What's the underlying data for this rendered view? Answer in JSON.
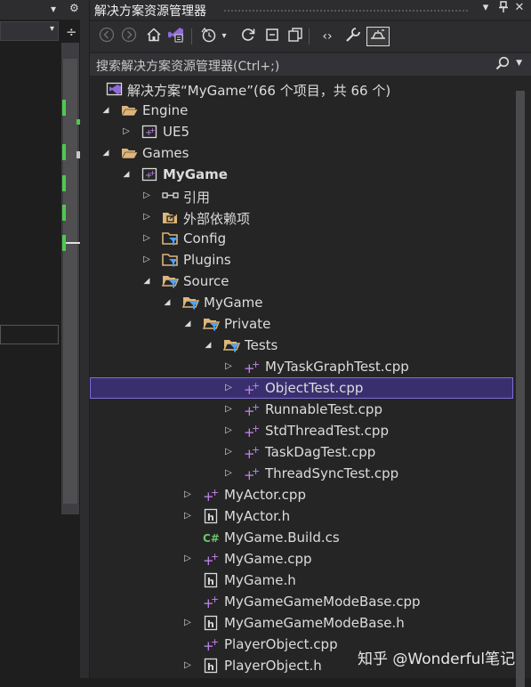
{
  "left_panel": {
    "pin_glyph": "▾",
    "gear_glyph": "⚙",
    "split_glyph": "÷"
  },
  "explorer": {
    "title": "解决方案资源管理器",
    "title_buttons": [
      "▾",
      "📌",
      "✕"
    ],
    "search_placeholder": "搜索解决方案资源管理器(Ctrl+;)",
    "toolbar_icons": [
      "back-icon",
      "forward-icon",
      "home-icon",
      "vs-switch-icon",
      "history-icon",
      "refresh-icon",
      "collapse-all-icon",
      "show-all-files-icon",
      "code-view-icon",
      "properties-wrench-icon",
      "preview-icon"
    ],
    "tree": [
      {
        "text": "解决方案“MyGame”(66 个项目，共 66 个)",
        "level": 0,
        "arrow": "",
        "icon": "solution",
        "bold": false
      },
      {
        "text": "Engine",
        "level": 1,
        "arrow": "open",
        "icon": "folder-open",
        "bold": false
      },
      {
        "text": "UE5",
        "level": 2,
        "arrow": "closed",
        "icon": "project",
        "bold": false
      },
      {
        "text": "Games",
        "level": 1,
        "arrow": "open",
        "icon": "folder-open",
        "bold": false
      },
      {
        "text": "MyGame",
        "level": 2,
        "arrow": "open",
        "icon": "project",
        "bold": true
      },
      {
        "text": "引用",
        "level": 3,
        "arrow": "closed",
        "icon": "references",
        "bold": false
      },
      {
        "text": "外部依赖项",
        "level": 3,
        "arrow": "closed",
        "icon": "external-deps",
        "bold": false
      },
      {
        "text": "Config",
        "level": 3,
        "arrow": "closed",
        "icon": "filter-folder",
        "bold": false
      },
      {
        "text": "Plugins",
        "level": 3,
        "arrow": "closed",
        "icon": "filter-folder",
        "bold": false
      },
      {
        "text": "Source",
        "level": 3,
        "arrow": "open",
        "icon": "filter-folder-open",
        "bold": false
      },
      {
        "text": "MyGame",
        "level": 4,
        "arrow": "open",
        "icon": "filter-folder-open",
        "bold": false
      },
      {
        "text": "Private",
        "level": 5,
        "arrow": "open",
        "icon": "filter-folder-open",
        "bold": false
      },
      {
        "text": "Tests",
        "level": 6,
        "arrow": "open",
        "icon": "filter-folder-open",
        "bold": false
      },
      {
        "text": "MyTaskGraphTest.cpp",
        "level": 7,
        "arrow": "closed",
        "icon": "cpp",
        "bold": false
      },
      {
        "text": "ObjectTest.cpp",
        "level": 7,
        "arrow": "closed",
        "icon": "cpp",
        "bold": false,
        "selected": true
      },
      {
        "text": "RunnableTest.cpp",
        "level": 7,
        "arrow": "closed",
        "icon": "cpp",
        "bold": false
      },
      {
        "text": "StdThreadTest.cpp",
        "level": 7,
        "arrow": "closed",
        "icon": "cpp",
        "bold": false
      },
      {
        "text": "TaskDagTest.cpp",
        "level": 7,
        "arrow": "closed",
        "icon": "cpp",
        "bold": false
      },
      {
        "text": "ThreadSyncTest.cpp",
        "level": 7,
        "arrow": "closed",
        "icon": "cpp",
        "bold": false
      },
      {
        "text": "MyActor.cpp",
        "level": 5,
        "arrow": "closed",
        "icon": "cpp",
        "bold": false
      },
      {
        "text": "MyActor.h",
        "level": 5,
        "arrow": "closed",
        "icon": "header",
        "bold": false
      },
      {
        "text": "MyGame.Build.cs",
        "level": 5,
        "arrow": "",
        "icon": "csharp",
        "bold": false
      },
      {
        "text": "MyGame.cpp",
        "level": 5,
        "arrow": "closed",
        "icon": "cpp",
        "bold": false
      },
      {
        "text": "MyGame.h",
        "level": 5,
        "arrow": "",
        "icon": "header",
        "bold": false
      },
      {
        "text": "MyGameGameModeBase.cpp",
        "level": 5,
        "arrow": "",
        "icon": "cpp",
        "bold": false
      },
      {
        "text": "MyGameGameModeBase.h",
        "level": 5,
        "arrow": "closed",
        "icon": "header",
        "bold": false
      },
      {
        "text": "PlayerObject.cpp",
        "level": 5,
        "arrow": "",
        "icon": "cpp",
        "bold": false
      },
      {
        "text": "PlayerObject.h",
        "level": 5,
        "arrow": "closed",
        "icon": "header",
        "bold": false
      }
    ]
  },
  "watermark": "知乎 @Wonderful笔记",
  "colors": {
    "panel_bg": "#252526",
    "selection_bg": "#3a2f6e",
    "selection_border": "#7f6dd8",
    "folder": "#dcb67a",
    "cpp_plus": "#c586f0",
    "filter_blue": "#4aa3ff",
    "csharp_green": "#6ac66a"
  }
}
